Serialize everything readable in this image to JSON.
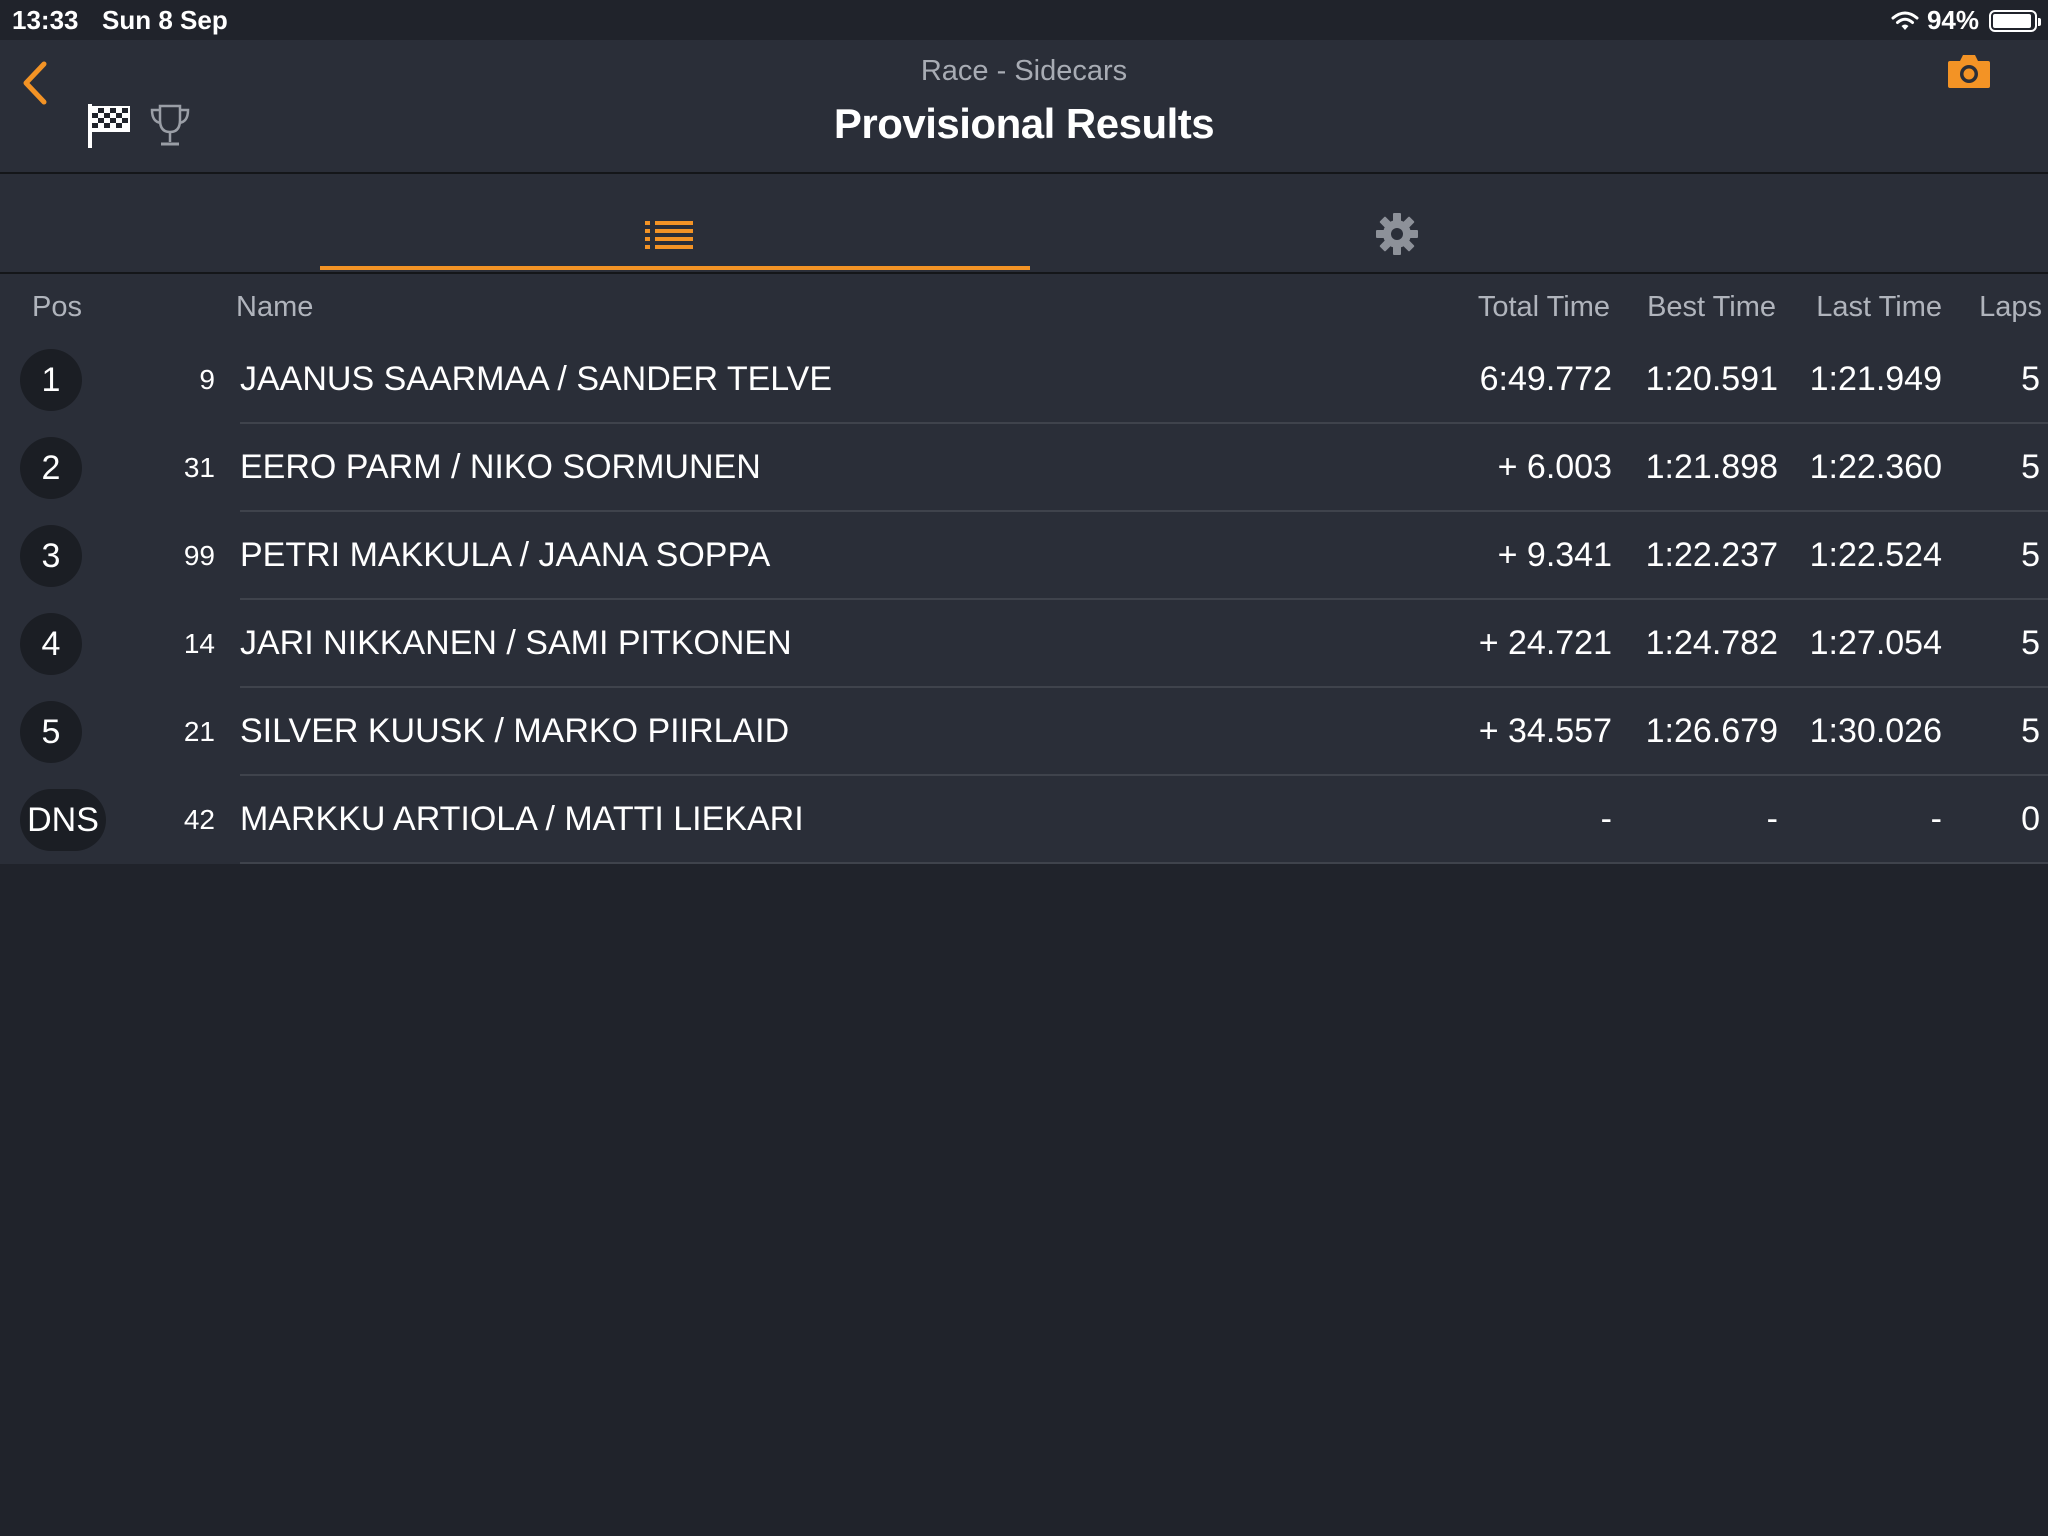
{
  "status_bar": {
    "time": "13:33",
    "date": "Sun 8 Sep",
    "battery_percent": "94%",
    "battery_level": 0.94
  },
  "header": {
    "subtitle": "Race - Sidecars",
    "title": "Provisional Results",
    "icons": [
      "chevron-left-icon",
      "checkered-flag-icon",
      "trophy-icon",
      "camera-icon"
    ]
  },
  "tabs": [
    {
      "icon": "list-icon",
      "active": true
    },
    {
      "icon": "gear-icon",
      "active": false
    }
  ],
  "colors": {
    "accent": "#f39325",
    "background": "#20232b",
    "panel": "#2a2e38",
    "badge": "#1b1e24",
    "header_text": "#b0b4bc"
  },
  "table": {
    "columns": {
      "pos": "Pos",
      "name": "Name",
      "total": "Total Time",
      "best": "Best Time",
      "last": "Last Time",
      "laps": "Laps"
    },
    "rows": [
      {
        "pos": "1",
        "num": "9",
        "name": "JAANUS SAARMAA / SANDER TELVE",
        "total": "6:49.772",
        "best": "1:20.591",
        "last": "1:21.949",
        "laps": "5"
      },
      {
        "pos": "2",
        "num": "31",
        "name": "EERO PARM / NIKO SORMUNEN",
        "total": "+ 6.003",
        "best": "1:21.898",
        "last": "1:22.360",
        "laps": "5"
      },
      {
        "pos": "3",
        "num": "99",
        "name": "PETRI MAKKULA / JAANA SOPPA",
        "total": "+ 9.341",
        "best": "1:22.237",
        "last": "1:22.524",
        "laps": "5"
      },
      {
        "pos": "4",
        "num": "14",
        "name": "JARI NIKKANEN / SAMI PITKONEN",
        "total": "+ 24.721",
        "best": "1:24.782",
        "last": "1:27.054",
        "laps": "5"
      },
      {
        "pos": "5",
        "num": "21",
        "name": "SILVER KUUSK / MARKO PIIRLAID",
        "total": "+ 34.557",
        "best": "1:26.679",
        "last": "1:30.026",
        "laps": "5"
      },
      {
        "pos": "DNS",
        "num": "42",
        "name": "MARKKU ARTIOLA /  MATTI LIEKARI",
        "total": "-",
        "best": "-",
        "last": "-",
        "laps": "0"
      }
    ]
  }
}
